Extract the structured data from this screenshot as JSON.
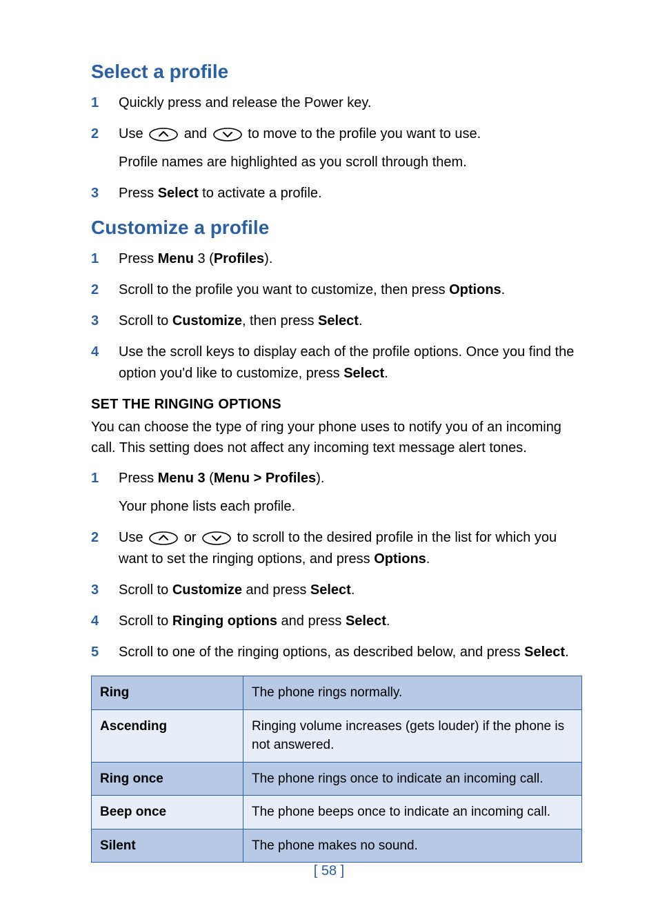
{
  "sections": {
    "select": {
      "title": "Select a profile",
      "steps": [
        {
          "n": "1",
          "a": "Quickly press and release the Power key."
        },
        {
          "n": "2",
          "a_pre": "Use ",
          "a_mid": " and ",
          "a_post": " to move to the profile you want to use.",
          "a_sub": "Profile names are highlighted as you scroll through them."
        },
        {
          "n": "3",
          "a_pre": "Press ",
          "a_b1": "Select",
          "a_post": " to activate a profile."
        }
      ]
    },
    "customize": {
      "title": "Customize a profile",
      "steps": [
        {
          "n": "1",
          "a_pre": "Press ",
          "a_b1": "Menu",
          "a_mid": " 3 (",
          "a_b2": "Profiles",
          "a_post": ")."
        },
        {
          "n": "2",
          "a_pre": "Scroll to the profile you want to customize, then press ",
          "a_b1": "Options",
          "a_post": "."
        },
        {
          "n": "3",
          "a_pre": "Scroll to ",
          "a_b1": "Customize",
          "a_mid": ", then press ",
          "a_b2": "Select",
          "a_post": "."
        },
        {
          "n": "4",
          "a_pre": "Use the scroll keys to display each of the profile options. Once you find the option you'd like to customize, press ",
          "a_b1": "Select",
          "a_post": "."
        }
      ]
    },
    "ringing": {
      "subheading": "SET THE RINGING OPTIONS",
      "intro": "You can choose the type of ring your phone uses to notify you of an incoming call. This setting does not affect any incoming text message alert tones.",
      "steps": [
        {
          "n": "1",
          "a_pre": "Press ",
          "a_b1": "Menu 3",
          "a_mid": " (",
          "a_b2": "Menu > Profiles",
          "a_post": ").",
          "a_sub": "Your phone lists each profile."
        },
        {
          "n": "2",
          "a_pre": "Use ",
          "a_mid": " or ",
          "a_post1": " to scroll to the desired profile in the list for which you want to set the ringing options, and press ",
          "a_b1": "Options",
          "a_post2": "."
        },
        {
          "n": "3",
          "a_pre": "Scroll to ",
          "a_b1": "Customize",
          "a_mid": " and press ",
          "a_b2": "Select",
          "a_post": "."
        },
        {
          "n": "4",
          "a_pre": "Scroll to ",
          "a_b1": "Ringing options",
          "a_mid": " and press ",
          "a_b2": "Select",
          "a_post": "."
        },
        {
          "n": "5",
          "a_pre": "Scroll to one of the ringing options, as described below, and press ",
          "a_b1": "Select",
          "a_post": "."
        }
      ]
    }
  },
  "table": [
    {
      "name": "Ring",
      "desc": "The phone rings normally."
    },
    {
      "name": "Ascending",
      "desc": "Ringing volume increases (gets louder) if the phone is not answered."
    },
    {
      "name": "Ring once",
      "desc": "The phone rings once to indicate an incoming call."
    },
    {
      "name": "Beep once",
      "desc": "The phone beeps once to indicate an incoming call."
    },
    {
      "name": "Silent",
      "desc": "The phone makes no sound."
    }
  ],
  "page_number": "[ 58 ]"
}
